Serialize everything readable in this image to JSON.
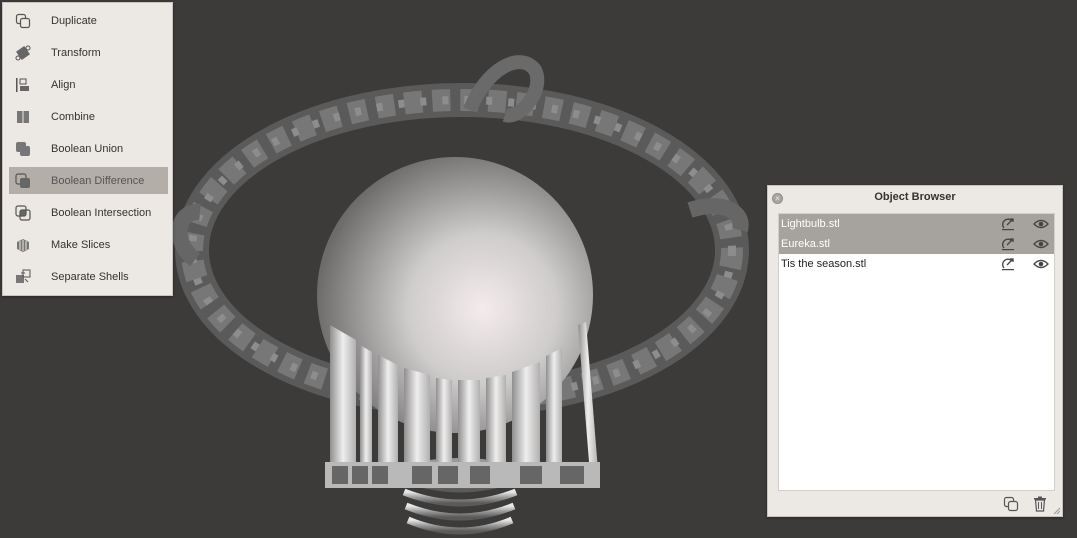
{
  "edit_menu": {
    "items": [
      {
        "label": "Duplicate",
        "icon": "duplicate-icon",
        "active": false
      },
      {
        "label": "Transform",
        "icon": "transform-icon",
        "active": false
      },
      {
        "label": "Align",
        "icon": "align-icon",
        "active": false
      },
      {
        "label": "Combine",
        "icon": "combine-icon",
        "active": false
      },
      {
        "label": "Boolean Union",
        "icon": "boolean-union-icon",
        "active": false
      },
      {
        "label": "Boolean Difference",
        "icon": "boolean-difference-icon",
        "active": true
      },
      {
        "label": "Boolean Intersection",
        "icon": "boolean-intersection-icon",
        "active": false
      },
      {
        "label": "Make Slices",
        "icon": "make-slices-icon",
        "active": false
      },
      {
        "label": "Separate Shells",
        "icon": "separate-shells-icon",
        "active": false
      }
    ]
  },
  "object_browser": {
    "title": "Object Browser",
    "close_icon": "close-icon",
    "items": [
      {
        "name": "Lightbulb.stl",
        "selected": true,
        "icons": [
          "snap-to-floor-icon",
          "eye-icon"
        ]
      },
      {
        "name": "Eureka.stl",
        "selected": true,
        "icons": [
          "snap-to-floor-icon",
          "eye-icon"
        ]
      },
      {
        "name": "Tis the season.stl",
        "selected": false,
        "icons": [
          "snap-to-floor-icon",
          "eye-icon"
        ]
      }
    ],
    "footer_icons": [
      "duplicate-icon",
      "trash-icon"
    ]
  },
  "colors": {
    "viewport_background": "#3c3b3a",
    "panel_background": "#ece8e3",
    "selection": "#a6a29d",
    "menu_active": "#b3aea8"
  }
}
